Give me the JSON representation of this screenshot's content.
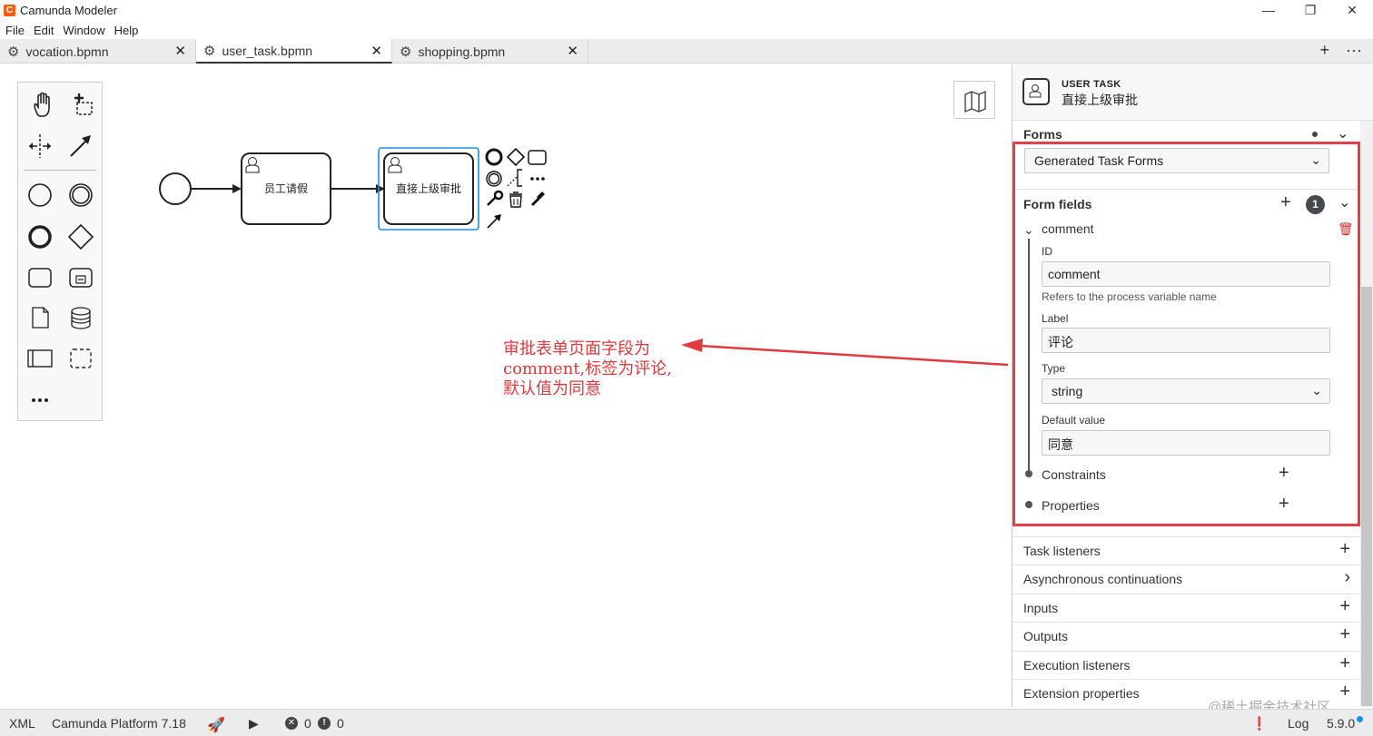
{
  "app": {
    "title": "Camunda Modeler",
    "window_controls": [
      "—",
      "❐",
      "✕"
    ]
  },
  "menu": [
    "File",
    "Edit",
    "Window",
    "Help"
  ],
  "tabs": [
    {
      "label": "vocation.bpmn",
      "active": false
    },
    {
      "label": "user_task.bpmn",
      "active": true
    },
    {
      "label": "shopping.bpmn",
      "active": false
    }
  ],
  "tab_actions": [
    "+",
    "···"
  ],
  "diagram": {
    "task1_label": "员工请假",
    "task2_label": "直接上级审批"
  },
  "annotation": {
    "line1": "审批表单页面字段为",
    "line2": "comment,标签为评论,",
    "line3": "默认值为同意"
  },
  "panel": {
    "element_type": "USER TASK",
    "element_name": "直接上级审批",
    "forms": {
      "title": "Forms",
      "form_type": "Generated Task Forms",
      "form_fields_title": "Form fields",
      "form_fields_count": "1",
      "field": {
        "name": "comment",
        "id_label": "ID",
        "id_value": "comment",
        "id_hint": "Refers to the process variable name",
        "label_label": "Label",
        "label_value": "评论",
        "type_label": "Type",
        "type_value": "string",
        "default_label": "Default value",
        "default_value": "同意",
        "constraints": "Constraints",
        "properties": "Properties"
      }
    },
    "sections": [
      {
        "label": "Task listeners",
        "action": "+"
      },
      {
        "label": "Asynchronous continuations",
        "action": "›"
      },
      {
        "label": "Inputs",
        "action": "+"
      },
      {
        "label": "Outputs",
        "action": "+"
      },
      {
        "label": "Execution listeners",
        "action": "+"
      },
      {
        "label": "Extension properties",
        "action": "+"
      }
    ]
  },
  "status": {
    "xml": "XML",
    "platform": "Camunda Platform 7.18",
    "errors": "0",
    "warnings": "0",
    "log": "Log",
    "version": "5.9.0"
  },
  "watermark": "@稀土掘金技术社区",
  "colors": {
    "accent": "#fc5d0d",
    "selection": "#1a8fe3",
    "annotation": "#e0393e"
  }
}
